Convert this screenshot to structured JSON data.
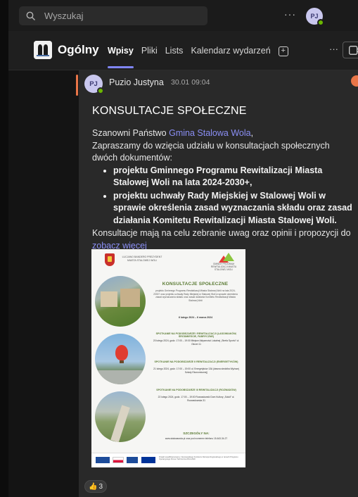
{
  "topbar": {
    "search_placeholder": "Wyszukaj",
    "more_label": "···",
    "user_initials": "PJ"
  },
  "channel": {
    "name": "Ogólny",
    "tabs": [
      {
        "label": "Wpisy",
        "active": true
      },
      {
        "label": "Pliki",
        "active": false
      },
      {
        "label": "Lists",
        "active": false
      },
      {
        "label": "Kalendarz wydarzeń",
        "active": false
      }
    ],
    "add_tab_label": "+",
    "more_label": "···"
  },
  "post": {
    "author_initials": "PJ",
    "author": "Puzio Justyna",
    "time": "30.01 09:04",
    "title": "KONSULTACJE SPOŁECZNE",
    "greeting_prefix": "Szanowni Państwo ",
    "greeting_link": "Gmina Stalowa Wola",
    "greeting_suffix": ",",
    "intro": "Zapraszamy do wzięcia udziału w konsultacjach społecznych dwóch dokumentów:",
    "items": [
      "projektu Gminnego Programu Rewitalizacji Miasta Stalowej Woli na lata 2024-2030+,",
      "projektu uchwały Rady Miejskiej w Stalowej Woli w sprawie określenia zasad wyznaczania składu oraz zasad działania Komitetu Rewitalizacji Miasta Stalowej Woli."
    ],
    "outro": "Konsultacje mają na celu zebranie uwag oraz opinii i propozycji do",
    "see_more": "zobacz więcej",
    "reaction": {
      "icon": "thumbs-up",
      "count": "3"
    }
  },
  "poster": {
    "head_left": "LUCJANO BANDERO PREZYDENT MIASTA STALOWEJ WOLI",
    "head_right": "GMINNY PROGRAM REWITALIZACJI MIASTA STALOWEJ WOLI",
    "title": "KONSULTACJE SPOŁECZNE",
    "subtitle": "projektu Gminnego Programu Rewitalizacji Miasta Stalowej Woli na lata 2024-2030+ oraz projektu uchwały Rady Miejskiej w Stalowej Woli w sprawie określenia zasad wyznaczania składu oraz zasad działania Komitetu Rewitalizacji Miasta Stalowej Woli",
    "dates": "6 lutego 2024 – 6 marca 2024",
    "meetings": [
      {
        "title": "SPOTKANIE NA PODOBSZARZE I REWITALIZACJI (LASOWIAKÓW, ŚRÓDMIEŚCIE, FABRYCZNE)",
        "body": "20 lutego 2024, godz. 17:00 – 19:00 Miejsce Aktywności Lokalnej „Strefa Sportu” ul. Okrzei 11"
      },
      {
        "title": "SPOTKANIE NA PODOBSZARZE II REWITALIZACJI (ENERGETYKÓW)",
        "body": "21 lutego 2024, godz. 17:00 – 19:00 ul. Energetyków 13A (dawna siedziba Wyższej Szkoły Ekonomicznej)"
      },
      {
        "title": "SPOTKANIE NA PODOBSZARZE III REWITALIZACJI (ROZWADÓW)",
        "body": "22 lutego 2024, godz. 17:00 – 19:00 Rozwadowski Dom Kultury „Sokół” ul. Rozwadowska 31"
      }
    ],
    "details_title": "SZCZEGÓŁY NA:",
    "details_body": "www.stalowawola.pl oraz pod numerem telefonu 15-643-34-27",
    "footer": "Projekt współfinansowany z Europejskiego Funduszu Rozwoju Regionalnego w ramach Programu Operacyjnego Pomoc Techniczna 2014-2020"
  },
  "colors": {
    "accent": "#7f85f5",
    "link": "#8b8ff5",
    "presence": "#6bb700",
    "post_marker": "#e97548"
  }
}
